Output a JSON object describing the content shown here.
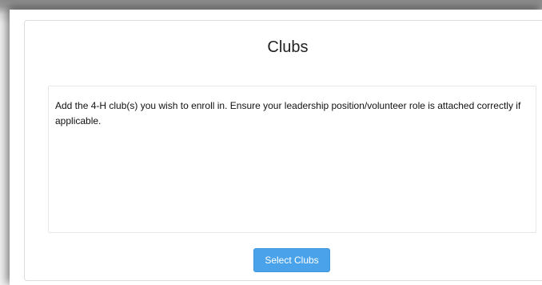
{
  "panel": {
    "title": "Clubs",
    "instructions": "Add the 4-H club(s) you wish to enroll in.  Ensure your leadership position/volunteer role is attached correctly if applicable.",
    "select_button_label": "Select Clubs"
  },
  "colors": {
    "button_bg": "#4aa3ea",
    "button_text": "#ffffff",
    "panel_border": "#dddddd"
  }
}
